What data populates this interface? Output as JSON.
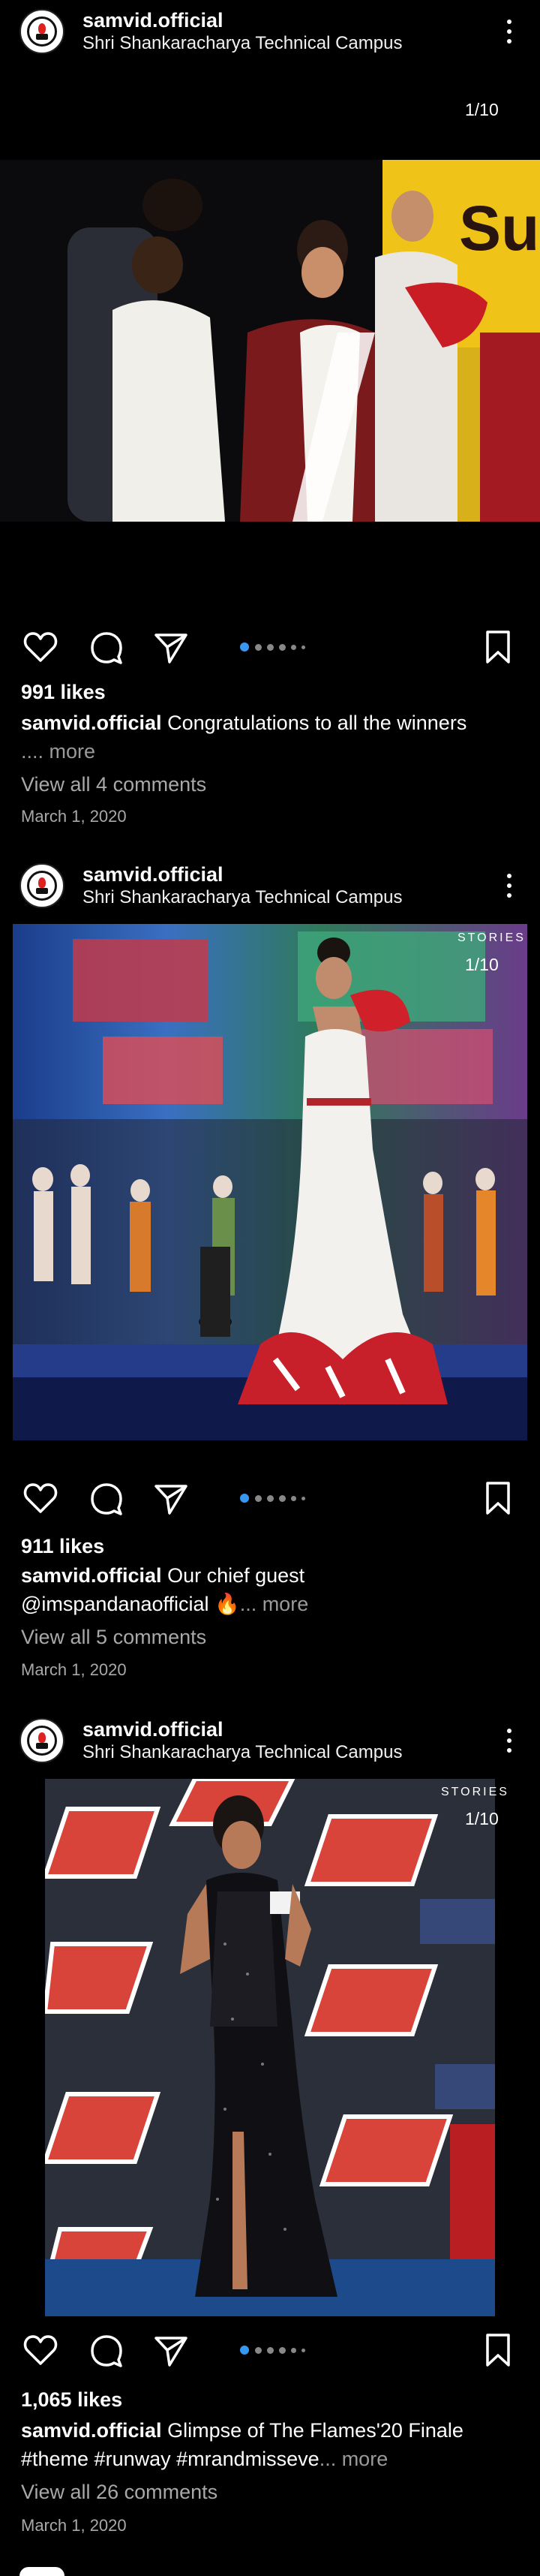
{
  "posts": [
    {
      "username": "samvid.official",
      "location": "Shri Shankaracharya Technical Campus",
      "counter": "1/10",
      "stories_tag": "",
      "likes": "991 likes",
      "caption_user": "samvid.official",
      "caption_text": "Congratulations to all the winners",
      "caption_line2": ".... more",
      "comments": "View all 4 comments",
      "date": "March 1, 2020",
      "image_text": "Sus"
    },
    {
      "username": "samvid.official",
      "location": "Shri Shankaracharya Technical Campus",
      "counter": "1/10",
      "stories_tag": "STORIES",
      "likes": "911 likes",
      "caption_user": "samvid.official",
      "caption_text": "Our chief guest",
      "caption_line2_main": "@imspandanaofficial 🔥",
      "caption_line2_more": "... more",
      "comments": "View all 5 comments",
      "date": "March 1, 2020"
    },
    {
      "username": "samvid.official",
      "location": "Shri Shankaracharya Technical Campus",
      "counter": "1/10",
      "stories_tag": "STORIES",
      "likes": "1,065 likes",
      "caption_user": "samvid.official",
      "caption_text": "Glimpse of The Flames'20 Finale",
      "caption_line2_main": "#theme #runway #mrandmisseve",
      "caption_line2_more": "... more",
      "comments": "View all 26 comments",
      "date": "March 1, 2020"
    }
  ],
  "colors": {
    "background": "#000000",
    "accent_dot": "#3897f0",
    "muted_text": "#a8a8a8"
  },
  "icons": [
    "avatar",
    "more-options-icon",
    "heart-icon",
    "comment-icon",
    "share-icon",
    "bookmark-icon"
  ]
}
